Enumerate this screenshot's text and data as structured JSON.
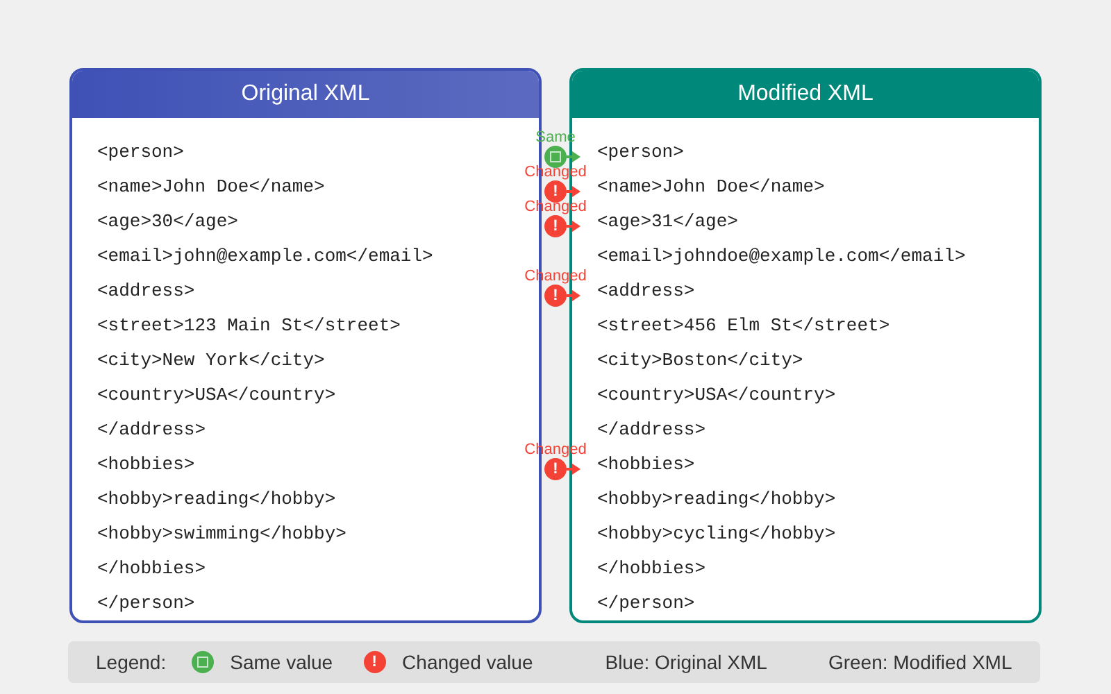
{
  "left_panel": {
    "title": "Original XML"
  },
  "right_panel": {
    "title": "Modified XML"
  },
  "rows": [
    {
      "left": "<person>",
      "right": "<person>",
      "marker": {
        "kind": "same",
        "label": "Same"
      }
    },
    {
      "left": "<name>John Doe</name>",
      "right": "<name>John Doe</name>",
      "marker": {
        "kind": "changed",
        "label": "Changed",
        "symbol": "!"
      }
    },
    {
      "left": "<age>30</age>",
      "right": "<age>31</age>",
      "marker": {
        "kind": "changed",
        "label": "Changed",
        "symbol": "!"
      }
    },
    {
      "left": "<email>john@example.com</email>",
      "right": "<email>johndoe@example.com</email>"
    },
    {
      "left": "<address>",
      "right": "<address>",
      "marker": {
        "kind": "changed",
        "label": "Changed",
        "symbol": "!"
      }
    },
    {
      "left": "<street>123 Main St</street>",
      "right": "<street>456 Elm St</street>"
    },
    {
      "left": "<city>New York</city>",
      "right": "<city>Boston</city>"
    },
    {
      "left": "<country>USA</country>",
      "right": "<country>USA</country>"
    },
    {
      "left": "</address>",
      "right": "</address>"
    },
    {
      "left": "<hobbies>",
      "right": "<hobbies>",
      "marker": {
        "kind": "changed",
        "label": "Changed",
        "symbol": "!"
      }
    },
    {
      "left": "<hobby>reading</hobby>",
      "right": "<hobby>reading</hobby>"
    },
    {
      "left": "<hobby>swimming</hobby>",
      "right": "<hobby>cycling</hobby>"
    },
    {
      "left": "</hobbies>",
      "right": "</hobbies>"
    },
    {
      "left": "</person>",
      "right": "</person>"
    }
  ],
  "legend": {
    "label": "Legend:",
    "items": [
      {
        "kind": "same",
        "text": "Same value"
      },
      {
        "kind": "changed",
        "symbol": "!",
        "text": "Changed value"
      },
      {
        "kind": "note",
        "text": "Blue: Original XML"
      },
      {
        "kind": "note",
        "text": "Green: Modified XML"
      }
    ]
  }
}
